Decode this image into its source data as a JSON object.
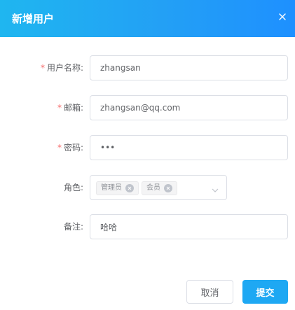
{
  "dialog": {
    "title": "新增用户",
    "close_icon": "close-icon"
  },
  "form": {
    "username": {
      "label": "用户名称:",
      "required": true,
      "value": "zhangsan"
    },
    "email": {
      "label": "邮箱:",
      "required": true,
      "value": "zhangsan@qq.com"
    },
    "password": {
      "label": "密码:",
      "required": true,
      "value": "•••"
    },
    "role": {
      "label": "角色:",
      "required": false,
      "tags": [
        "管理员",
        "会员"
      ],
      "arrow_icon": "chevron-down-icon"
    },
    "remark": {
      "label": "备注:",
      "required": false,
      "value": "哈哈"
    },
    "required_mark": "*"
  },
  "footer": {
    "cancel_label": "取消",
    "submit_label": "提交"
  },
  "colors": {
    "accent": "#1ea8f3",
    "required": "#f56c6c",
    "border": "#dcdfe6"
  }
}
